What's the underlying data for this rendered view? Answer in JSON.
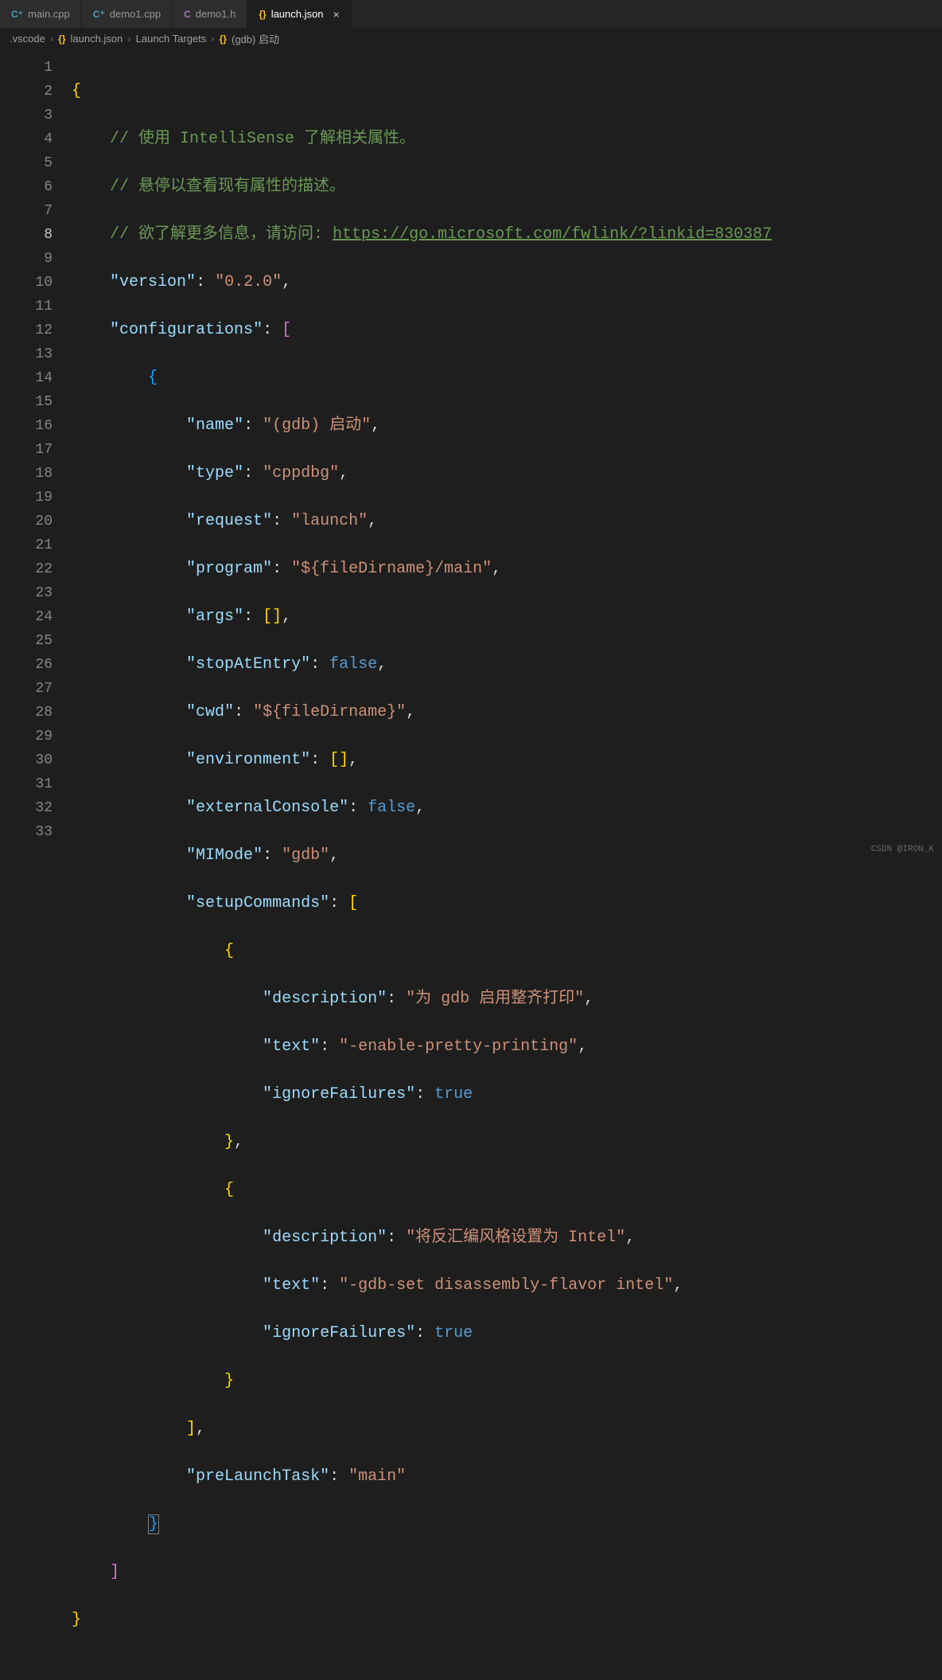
{
  "tabs": [
    {
      "icon": "C⁺",
      "label": "main.cpp",
      "active": false
    },
    {
      "icon": "C⁺",
      "label": "demo1.cpp",
      "active": false
    },
    {
      "icon": "C",
      "label": "demo1.h",
      "active": false
    },
    {
      "icon": "{}",
      "label": "launch.json",
      "active": true
    }
  ],
  "breadcrumbs": {
    "parts": [
      ".vscode",
      "launch.json",
      "Launch Targets",
      "(gdb) 启动"
    ],
    "icons": [
      "",
      "{}",
      "",
      "{}"
    ]
  },
  "json_content": {
    "comments": [
      "使用 IntelliSense 了解相关属性。",
      "悬停以查看现有属性的描述。",
      "欲了解更多信息，请访问: "
    ],
    "link": "https://go.microsoft.com/fwlink/?linkid=830387",
    "version_key": "version",
    "version_val": "0.2.0",
    "configurations_key": "configurations",
    "config": {
      "name_key": "name",
      "name_val": "(gdb) 启动",
      "type_key": "type",
      "type_val": "cppdbg",
      "request_key": "request",
      "request_val": "launch",
      "program_key": "program",
      "program_val": "${fileDirname}/main",
      "args_key": "args",
      "stopAtEntry_key": "stopAtEntry",
      "stopAtEntry_val": "false",
      "cwd_key": "cwd",
      "cwd_val": "${fileDirname}",
      "environment_key": "environment",
      "externalConsole_key": "externalConsole",
      "externalConsole_val": "false",
      "MIMode_key": "MIMode",
      "MIMode_val": "gdb",
      "setupCommands_key": "setupCommands",
      "setup1": {
        "desc_key": "description",
        "desc_val": "为 gdb 启用整齐打印",
        "text_key": "text",
        "text_val": "-enable-pretty-printing",
        "ign_key": "ignoreFailures",
        "ign_val": "true"
      },
      "setup2": {
        "desc_key": "description",
        "desc_val": "将反汇编风格设置为 Intel",
        "text_key": "text",
        "text_val": "-gdb-set disassembly-flavor intel",
        "ign_key": "ignoreFailures",
        "ign_val": "true"
      },
      "preLaunchTask_key": "preLaunchTask",
      "preLaunchTask_val": "main"
    }
  },
  "line_count": 33,
  "current_line": 8,
  "watermark": "CSDN @IRON_K"
}
